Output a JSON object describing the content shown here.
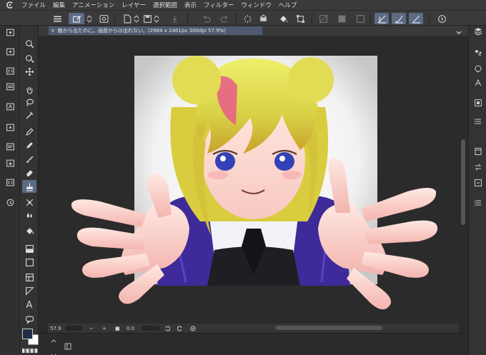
{
  "menu": {
    "items": [
      "ファイル",
      "編集",
      "アニメーション",
      "レイヤー",
      "選択範囲",
      "表示",
      "フィルター",
      "ウィンドウ",
      "ヘルプ"
    ]
  },
  "document": {
    "tab_close": "×",
    "tab_title": "触から出たのに。画面からは出れない。(2984 x 2461px 300dpi 57.9%)"
  },
  "status": {
    "zoom": "57.9",
    "minus": "−",
    "plus": "+",
    "rotation": "0.0"
  },
  "icons": {
    "app": "clip-studio-logo-icon",
    "commands": [
      "hamburger-menu-icon",
      "canvas-mode-icon",
      "updown-arrows-icon",
      "canvas-preview-icon",
      "new-file-icon",
      "updown-arrows-icon",
      "save-icon",
      "updown-arrows-icon",
      "import-icon",
      "undo-icon",
      "redo-icon",
      "loading-spinner-icon",
      "fill-bucket-icon",
      "transform-icon",
      "clear-icon",
      "select-all-icon",
      "deselect-icon",
      "snap-ruler-icon",
      "snap-pen-icon",
      "snap-special-icon",
      "assist-icon"
    ],
    "tools": [
      "zoom-icon",
      "object-select-icon",
      "move-icon",
      "hand-icon",
      "lasso-icon",
      "eyedropper-icon",
      "pen-icon",
      "pencil-icon",
      "brush-icon",
      "eraser-icon",
      "fill-icon",
      "blend-icon",
      "airbrush-icon",
      "paint-bucket-icon",
      "gradient-icon",
      "rectangle-icon",
      "frame-icon",
      "ruler-icon",
      "text-icon",
      "balloon-icon"
    ],
    "left_panels": [
      "palette-icon",
      "sub-view-icon",
      "color-set-icon",
      "layer-props-icon",
      "material-icon",
      "history-icon",
      "navigator-icon",
      "tool-property-icon",
      "brush-size-icon",
      "search-icon"
    ],
    "right_panels": [
      "layers-icon",
      "auto-action-icon",
      "color-wheel-icon",
      "material-a-icon",
      "layer-search-icon",
      "layer-list-icon",
      "timeline-icon",
      "page-icon",
      "history-list-icon"
    ]
  },
  "colors": {
    "accent": "#5c6b86",
    "main_color": "#1f2d48",
    "sub_color": "#ffffff",
    "canvas_bg": "#2b2b2b"
  }
}
